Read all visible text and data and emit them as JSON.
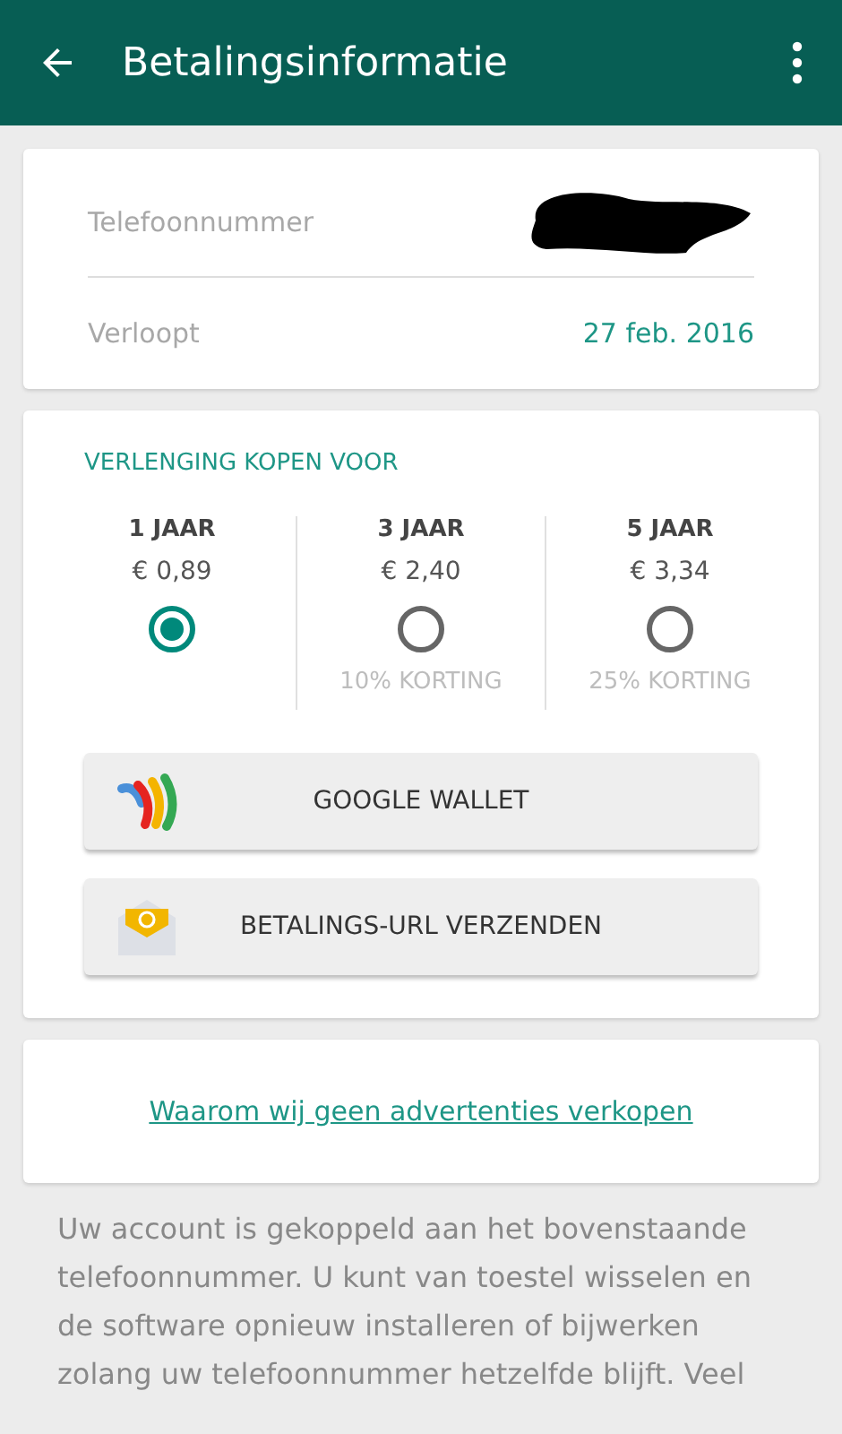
{
  "app_bar": {
    "title": "Betalingsinformatie"
  },
  "account": {
    "rows": [
      {
        "kind": "redacted",
        "label": "Telefoonnummer"
      },
      {
        "kind": "value",
        "label": "Verloopt",
        "value": "27 feb. 2016"
      }
    ]
  },
  "renewal": {
    "heading": "VERLENGING KOPEN VOOR",
    "options": [
      {
        "period": "1 JAAR",
        "price": "€ 0,89",
        "selected": true
      },
      {
        "period": "3 JAAR",
        "price": "€ 2,40",
        "selected": false,
        "discount": "10% KORTING"
      },
      {
        "period": "5 JAAR",
        "price": "€ 3,34",
        "selected": false,
        "discount": "25% KORTING"
      }
    ],
    "buttons": [
      {
        "kind": "wallet",
        "label": "GOOGLE WALLET"
      },
      {
        "kind": "mail",
        "label": "BETALINGS-URL VERZENDEN"
      }
    ]
  },
  "link": "Waarom wij geen advertenties verkopen",
  "footer_text": "Uw account is gekoppeld aan het bovenstaande telefoonnummer. U kunt van toestel wisselen en de software opnieuw installeren of bijwerken zolang uw telefoonnummer hetzelfde blijft. Veel"
}
